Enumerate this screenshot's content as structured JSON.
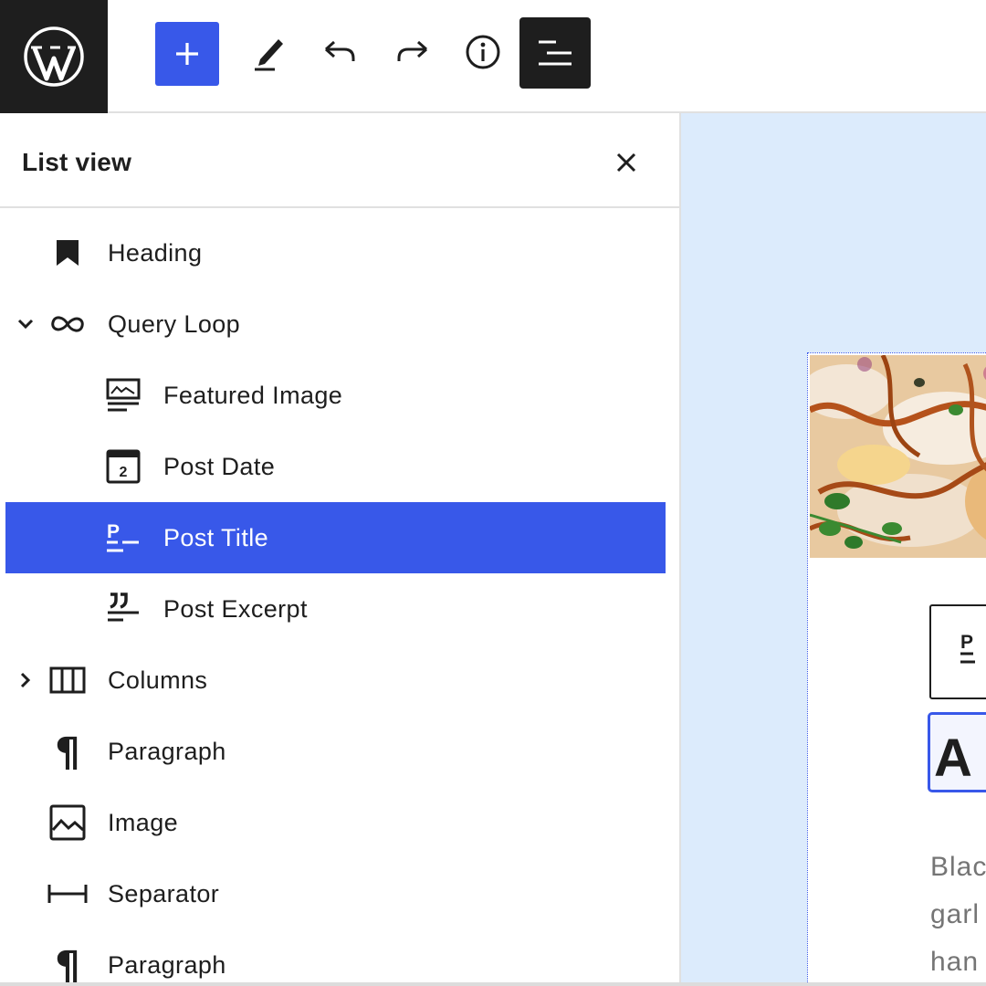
{
  "colors": {
    "accent": "#3858e9",
    "dark": "#1e1e1e",
    "canvas_bg": "#dcebfc",
    "selected_text": "#ffffff"
  },
  "toolbar": {
    "logo_icon": "wordpress-logo",
    "buttons": [
      {
        "name": "inserter",
        "icon": "plus-icon",
        "active": true
      },
      {
        "name": "tools",
        "icon": "pencil-icon"
      },
      {
        "name": "undo",
        "icon": "undo-icon"
      },
      {
        "name": "redo",
        "icon": "redo-icon"
      },
      {
        "name": "details",
        "icon": "info-icon"
      },
      {
        "name": "list-view",
        "icon": "list-view-icon",
        "active": true
      }
    ]
  },
  "list_view": {
    "title": "List view",
    "close_icon": "close-icon",
    "items": [
      {
        "label": "Heading",
        "icon": "bookmark-icon",
        "level": 1
      },
      {
        "label": "Query Loop",
        "icon": "loop-icon",
        "level": 1,
        "expander": "chevron-down-icon"
      },
      {
        "label": "Featured Image",
        "icon": "featured-image-icon",
        "level": 2
      },
      {
        "label": "Post Date",
        "icon": "calendar-icon",
        "level": 2,
        "icon_text": "2"
      },
      {
        "label": "Post Title",
        "icon": "post-title-icon",
        "level": 2,
        "selected": true,
        "icon_text": "P"
      },
      {
        "label": "Post Excerpt",
        "icon": "post-excerpt-icon",
        "level": 2
      },
      {
        "label": "Columns",
        "icon": "columns-icon",
        "level": 1,
        "expander": "chevron-right-icon"
      },
      {
        "label": "Paragraph",
        "icon": "paragraph-icon",
        "level": 1,
        "icon_text": "¶"
      },
      {
        "label": "Image",
        "icon": "image-icon",
        "level": 1
      },
      {
        "label": "Separator",
        "icon": "separator-icon",
        "level": 1
      },
      {
        "label": "Paragraph",
        "icon": "paragraph-icon",
        "level": 1,
        "icon_text": "¶"
      }
    ]
  },
  "canvas": {
    "block_toolbar_icon_text": "P",
    "post_title_text": "A",
    "excerpt_lines": [
      "Blac",
      "garl",
      "han"
    ]
  }
}
